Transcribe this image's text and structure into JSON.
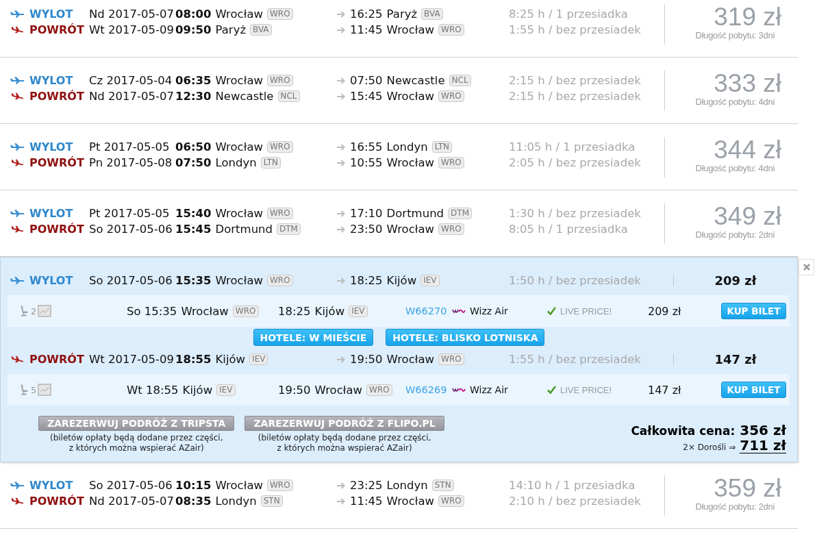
{
  "results": [
    {
      "kind": "summary",
      "legs": [
        {
          "kind": "outbound",
          "label": "WYLOT",
          "date": "Nd 2017-05-07",
          "time": "08:00",
          "from_city": "Wrocław",
          "from_code": "WRO",
          "arrival": "16:25",
          "to_city": "Paryż",
          "to_code": "BVA",
          "duration": "8:25 h / 1 przesiadka"
        },
        {
          "kind": "return",
          "label": "POWRÓT",
          "date": "Wt 2017-05-09",
          "time": "09:50",
          "from_city": "Paryż",
          "from_code": "BVA",
          "arrival": "11:45",
          "to_city": "Wrocław",
          "to_code": "WRO",
          "duration": "1:55 h / bez przesiadek"
        }
      ],
      "price": "319 zł",
      "stay": "Długość pobytu: 3dni"
    },
    {
      "kind": "summary",
      "legs": [
        {
          "kind": "outbound",
          "label": "WYLOT",
          "date": "Cz 2017-05-04",
          "time": "06:35",
          "from_city": "Wrocław",
          "from_code": "WRO",
          "arrival": "07:50",
          "to_city": "Newcastle",
          "to_code": "NCL",
          "duration": "2:15 h / bez przesiadek"
        },
        {
          "kind": "return",
          "label": "POWRÓT",
          "date": "Nd 2017-05-07",
          "time": "12:30",
          "from_city": "Newcastle",
          "from_code": "NCL",
          "arrival": "15:45",
          "to_city": "Wrocław",
          "to_code": "WRO",
          "duration": "2:15 h / bez przesiadek"
        }
      ],
      "price": "333 zł",
      "stay": "Długość pobytu: 4dni"
    },
    {
      "kind": "summary",
      "legs": [
        {
          "kind": "outbound",
          "label": "WYLOT",
          "date": "Pt 2017-05-05",
          "time": "06:50",
          "from_city": "Wrocław",
          "from_code": "WRO",
          "arrival": "16:55",
          "to_city": "Londyn",
          "to_code": "LTN",
          "duration": "11:05 h / 1 przesiadka"
        },
        {
          "kind": "return",
          "label": "POWRÓT",
          "date": "Pn 2017-05-08",
          "time": "07:50",
          "from_city": "Londyn",
          "from_code": "LTN",
          "arrival": "10:55",
          "to_city": "Wrocław",
          "to_code": "WRO",
          "duration": "2:05 h / bez przesiadek"
        }
      ],
      "price": "344 zł",
      "stay": "Długość pobytu: 4dni"
    },
    {
      "kind": "summary",
      "legs": [
        {
          "kind": "outbound",
          "label": "WYLOT",
          "date": "Pt 2017-05-05",
          "time": "15:40",
          "from_city": "Wrocław",
          "from_code": "WRO",
          "arrival": "17:10",
          "to_city": "Dortmund",
          "to_code": "DTM",
          "duration": "1:30 h / bez przesiadek"
        },
        {
          "kind": "return",
          "label": "POWRÓT",
          "date": "So 2017-05-06",
          "time": "15:45",
          "from_city": "Dortmund",
          "from_code": "DTM",
          "arrival": "23:50",
          "to_city": "Wrocław",
          "to_code": "WRO",
          "duration": "8:05 h / 1 przesiadka"
        }
      ],
      "price": "349 zł",
      "stay": "Długość pobytu: 2dni"
    },
    {
      "kind": "expanded",
      "legs": [
        {
          "kind": "outbound",
          "label": "WYLOT",
          "date": "So 2017-05-06",
          "time": "15:35",
          "from_city": "Wrocław",
          "from_code": "WRO",
          "arrival": "18:25",
          "to_city": "Kijów",
          "to_code": "IEV",
          "duration": "1:50 h / bez przesiadek",
          "price": "209 zł",
          "segment": {
            "seat_count": "2",
            "day_time": "So 15:35",
            "from_city": "Wrocław",
            "from_code": "WRO",
            "arrival": "18:25",
            "to_city": "Kijów",
            "to_code": "IEV",
            "flight": "W66270",
            "airline": "Wizz Air",
            "live_label": "LIVE PRICE!",
            "price": "209 zł",
            "buy_label": "KUP BILET"
          },
          "hotels": [
            "HOTELE: W MIEŚCIE",
            "HOTELE: BLISKO LOTNISKA"
          ]
        },
        {
          "kind": "return",
          "label": "POWRÓT",
          "date": "Wt 2017-05-09",
          "time": "18:55",
          "from_city": "Kijów",
          "from_code": "IEV",
          "arrival": "19:50",
          "to_city": "Wrocław",
          "to_code": "WRO",
          "duration": "1:55 h / bez przesiadek",
          "price": "147 zł",
          "segment": {
            "seat_count": "5",
            "day_time": "Wt 18:55",
            "from_city": "Kijów",
            "from_code": "IEV",
            "arrival": "19:50",
            "to_city": "Wrocław",
            "to_code": "WRO",
            "flight": "W66269",
            "airline": "Wizz Air",
            "live_label": "LIVE PRICE!",
            "price": "147 zł",
            "buy_label": "KUP BILET"
          }
        }
      ],
      "booking_options": [
        {
          "label": "ZAREZERWUJ PODRÓŻ Z TRIPSTA",
          "note": [
            "(biletów opłaty będą dodane przez części,",
            "z których można wspierać AZair)"
          ]
        },
        {
          "label": "ZAREZERWUJ PODRÓŻ Z FLIPO.PL",
          "note": [
            "(biletów opłaty będą dodane przez części,",
            "z których można wspierać AZair)"
          ]
        }
      ],
      "total": {
        "label": "Całkowita cena:",
        "price": "356 zł",
        "passengers": "2× Dorośli ⇒",
        "grand_total": "711 zł"
      }
    },
    {
      "kind": "summary",
      "legs": [
        {
          "kind": "outbound",
          "label": "WYLOT",
          "date": "So 2017-05-06",
          "time": "10:15",
          "from_city": "Wrocław",
          "from_code": "WRO",
          "arrival": "23:25",
          "to_city": "Londyn",
          "to_code": "STN",
          "duration": "14:10 h / 1 przesiadka"
        },
        {
          "kind": "return",
          "label": "POWRÓT",
          "date": "Nd 2017-05-07",
          "time": "08:35",
          "from_city": "Londyn",
          "from_code": "STN",
          "arrival": "11:45",
          "to_city": "Wrocław",
          "to_code": "WRO",
          "duration": "2:10 h / bez przesiadek"
        }
      ],
      "price": "359 zł",
      "stay": "Długość pobytu: 2dni"
    }
  ]
}
